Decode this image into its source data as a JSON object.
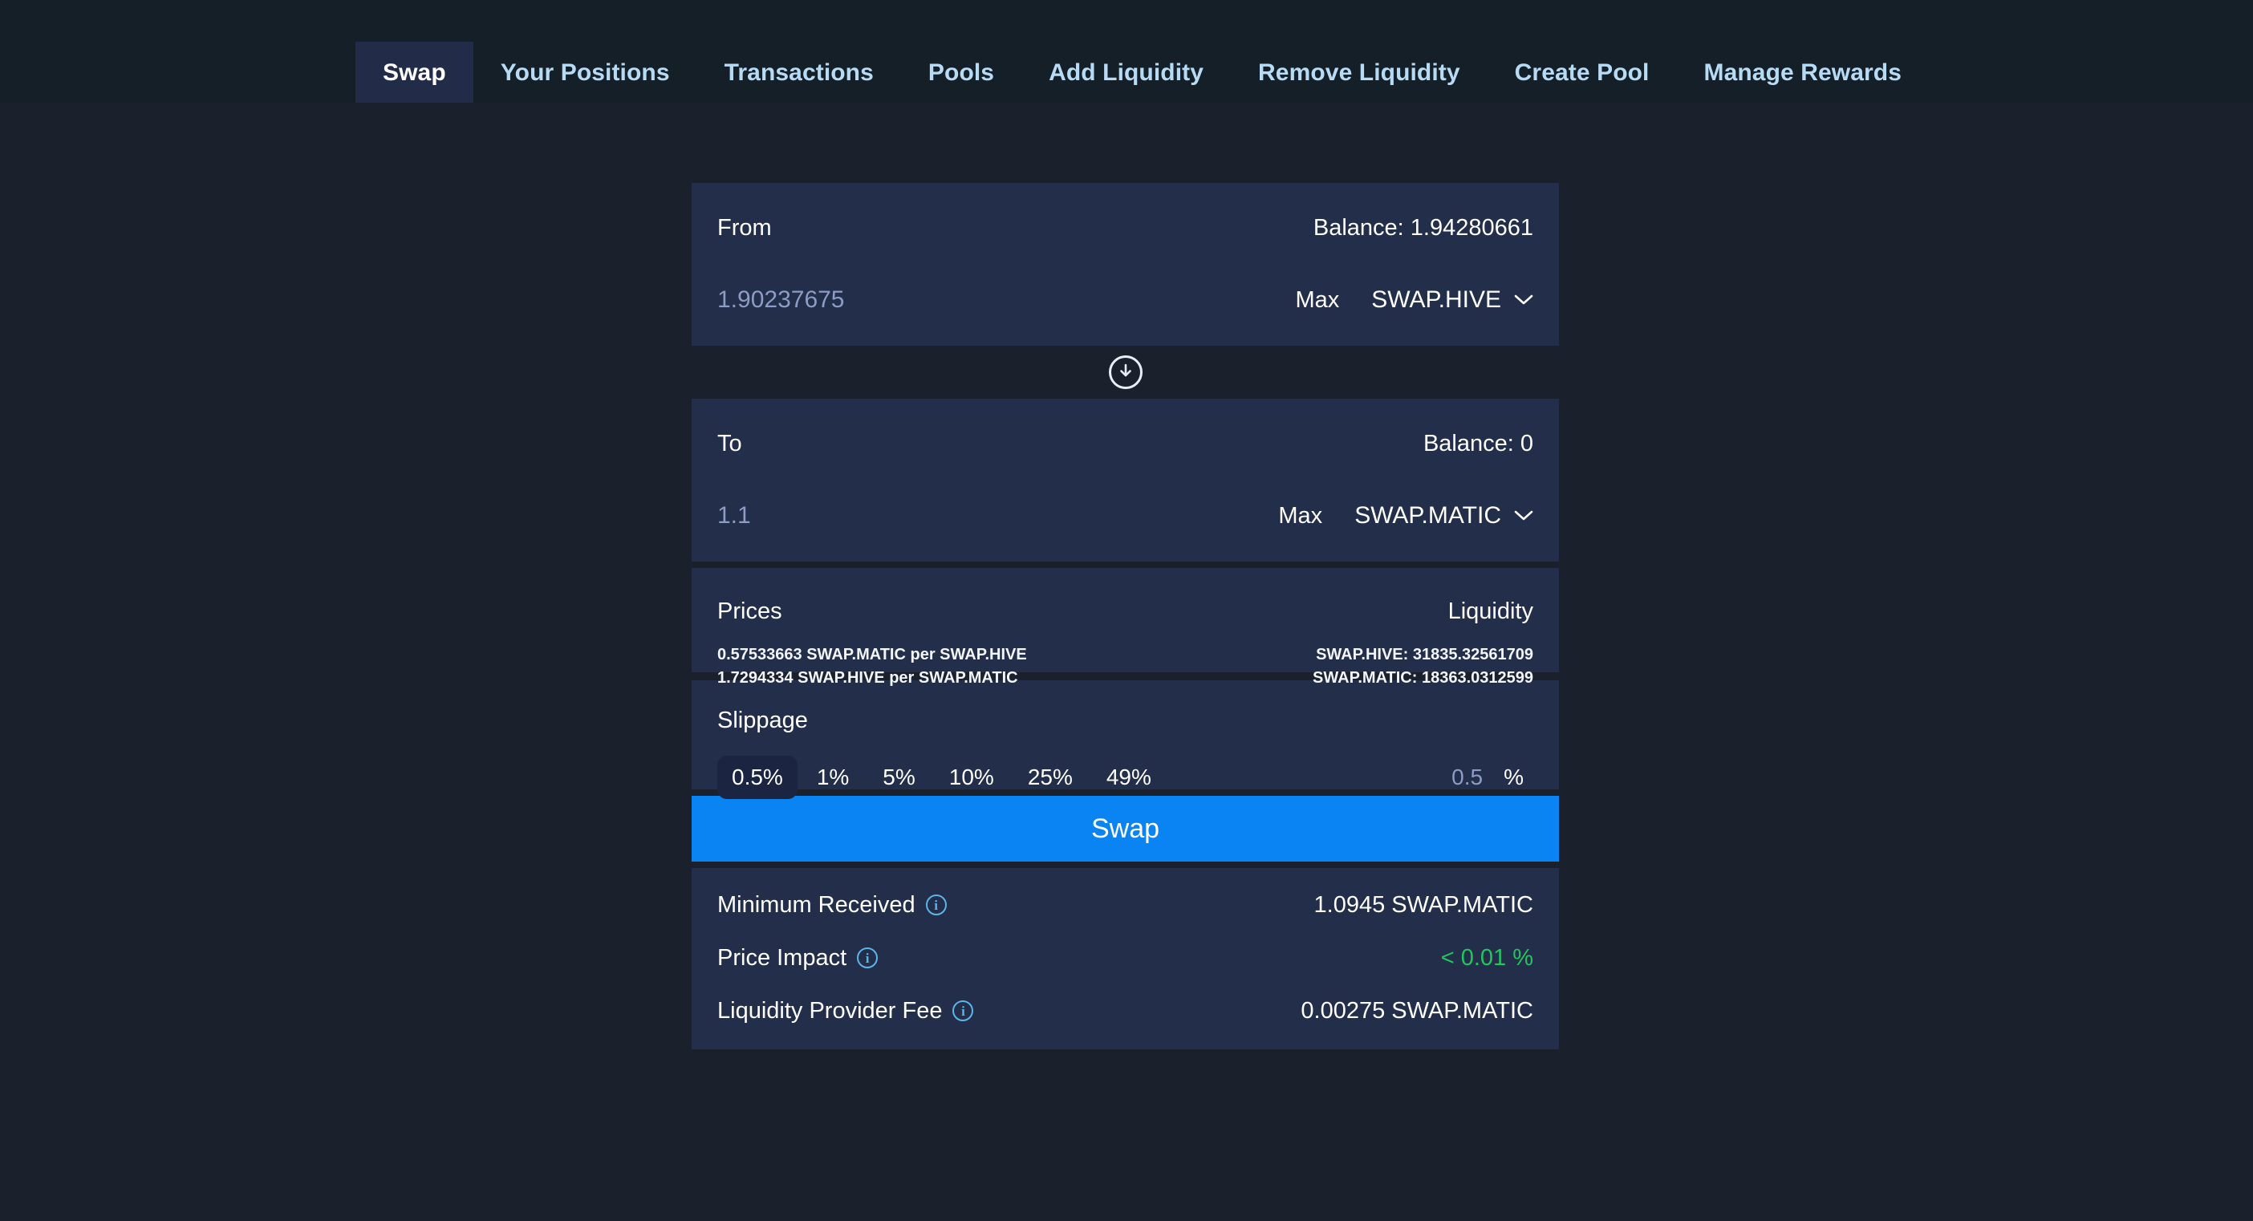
{
  "nav": {
    "tabs": [
      {
        "label": "Swap",
        "active": true
      },
      {
        "label": "Your Positions",
        "active": false
      },
      {
        "label": "Transactions",
        "active": false
      },
      {
        "label": "Pools",
        "active": false
      },
      {
        "label": "Add Liquidity",
        "active": false
      },
      {
        "label": "Remove Liquidity",
        "active": false
      },
      {
        "label": "Create Pool",
        "active": false
      },
      {
        "label": "Manage Rewards",
        "active": false
      }
    ]
  },
  "from": {
    "label": "From",
    "balance": "Balance: 1.94280661",
    "amount": "1.90237675",
    "max_label": "Max",
    "token": "SWAP.HIVE"
  },
  "to": {
    "label": "To",
    "balance": "Balance: 0",
    "amount": "1.1",
    "max_label": "Max",
    "token": "SWAP.MATIC"
  },
  "prices": {
    "title": "Prices",
    "lines": [
      "0.57533663 SWAP.MATIC per SWAP.HIVE",
      "1.7294334 SWAP.HIVE per SWAP.MATIC"
    ]
  },
  "liquidity": {
    "title": "Liquidity",
    "lines": [
      "SWAP.HIVE: 31835.32561709",
      "SWAP.MATIC: 18363.0312599"
    ]
  },
  "slippage": {
    "title": "Slippage",
    "presets": [
      "0.5%",
      "1%",
      "5%",
      "10%",
      "25%",
      "49%"
    ],
    "selected": "0.5%",
    "value": "0.5",
    "unit": "%"
  },
  "swap_button": {
    "label": "Swap"
  },
  "summary": {
    "rows": [
      {
        "label": "Minimum Received",
        "value": "1.0945 SWAP.MATIC",
        "positive": false
      },
      {
        "label": "Price Impact",
        "value": "< 0.01 %",
        "positive": true
      },
      {
        "label": "Liquidity Provider Fee",
        "value": "0.00275 SWAP.MATIC",
        "positive": false
      }
    ]
  },
  "colors": {
    "accent": "#0b84f3",
    "background": "#1a212d",
    "panel": "#232e4a",
    "nav_bar": "#141f27",
    "nav_link": "#b8dbf5",
    "muted_input": "#8d9cc4",
    "green": "#22c55e",
    "info_icon": "#5cb4e8"
  }
}
